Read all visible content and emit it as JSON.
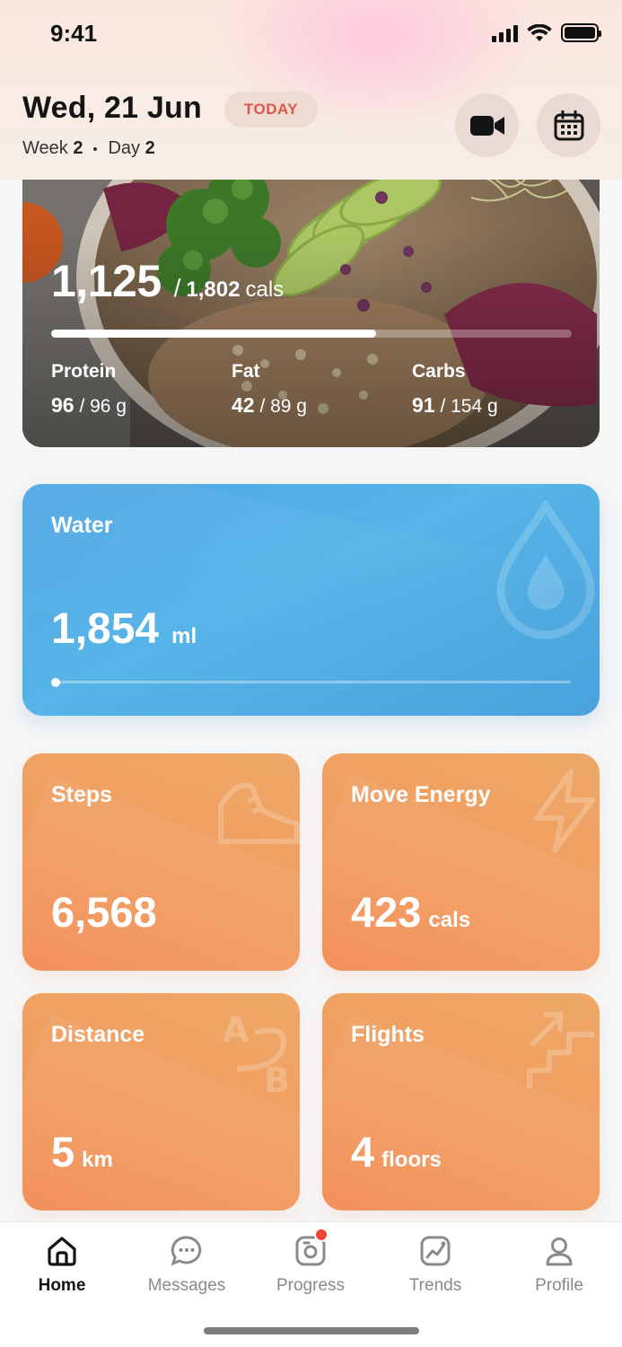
{
  "status_bar": {
    "time": "9:41"
  },
  "header": {
    "date": "Wed, 21 Jun",
    "badge": "TODAY",
    "week_label": "Week",
    "week_num": "2",
    "day_label": "Day",
    "day_num": "2",
    "buttons": [
      "video-camera-icon",
      "calendar-icon"
    ]
  },
  "calories": {
    "consumed": "1,125",
    "separator": "/",
    "goal": "1,802",
    "unit": "cals",
    "progress": 0.624,
    "macros": [
      {
        "label": "Protein",
        "value": "96",
        "goal": "/ 96 g"
      },
      {
        "label": "Fat",
        "value": "42",
        "goal": "/ 89 g"
      },
      {
        "label": "Carbs",
        "value": "91",
        "goal": "/ 154 g"
      }
    ]
  },
  "water": {
    "title": "Water",
    "value": "1,854",
    "unit": "ml",
    "progress": 0.0,
    "icon": "water-drop-icon"
  },
  "tiles": [
    {
      "title": "Steps",
      "value": "6,568",
      "unit": "",
      "icon": "shoe-icon"
    },
    {
      "title": "Move Energy",
      "value": "423",
      "unit": "cals",
      "icon": "lightning-icon"
    },
    {
      "title": "Distance",
      "value": "5",
      "unit": "km",
      "icon": "a-to-b-icon"
    },
    {
      "title": "Flights",
      "value": "4",
      "unit": "floors",
      "icon": "stairs-icon"
    }
  ],
  "tabbar": {
    "tabs": [
      {
        "label": "Home",
        "icon": "home-icon",
        "active": true
      },
      {
        "label": "Messages",
        "icon": "chat-icon",
        "active": false
      },
      {
        "label": "Progress",
        "icon": "camera-icon",
        "active": false,
        "notification": true
      },
      {
        "label": "Trends",
        "icon": "trend-chart-icon",
        "active": false
      },
      {
        "label": "Profile",
        "icon": "person-icon",
        "active": false
      }
    ]
  },
  "colors": {
    "badge_text": "#e0564b",
    "water": "#4fa6e4",
    "tile": "#f19c5e",
    "notification": "#ef4638"
  }
}
